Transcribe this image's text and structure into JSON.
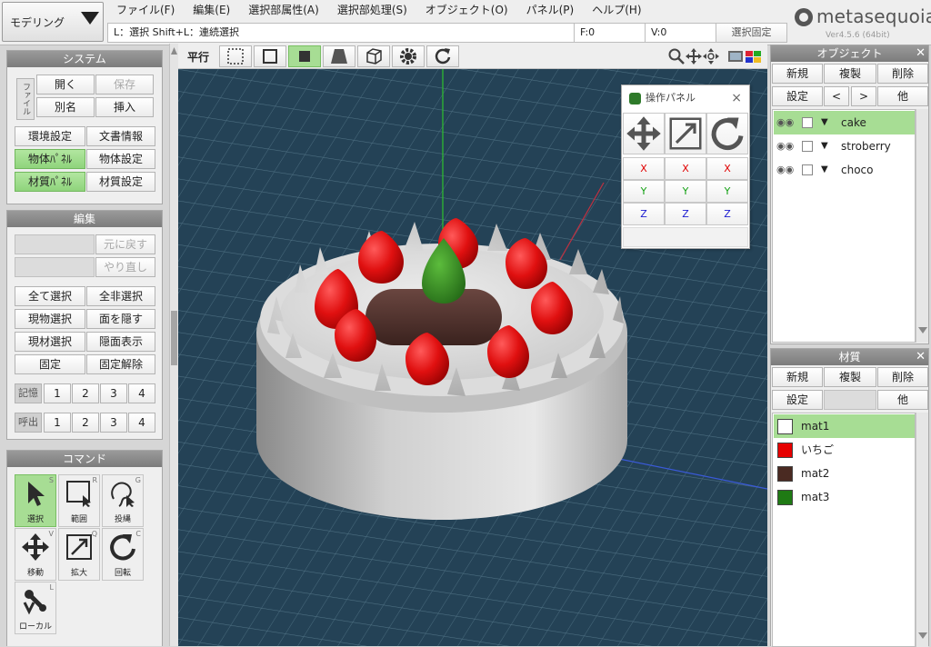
{
  "mode_select": {
    "value": "モデリング"
  },
  "menu": [
    "ファイル(F)",
    "編集(E)",
    "選択部属性(A)",
    "選択部処理(S)",
    "オブジェクト(O)",
    "パネル(P)",
    "ヘルプ(H)"
  ],
  "status": {
    "hint": "L：選択  Shift+L：連続選択",
    "faces": "F:0",
    "vertices": "V:0",
    "lock_label": "選択固定"
  },
  "logo": {
    "name": "metasequoia4",
    "version": "Ver4.5.6 (64bit)"
  },
  "system_panel": {
    "title": "システム",
    "file_tab": "ファイル",
    "open": "開く",
    "save": "保存",
    "save_as": "別名",
    "insert": "挿入",
    "env_settings": "環境設定",
    "doc_info": "文書情報",
    "object_panel": "物体ﾊﾟﾈﾙ",
    "object_settings": "物体設定",
    "material_panel": "材質ﾊﾟﾈﾙ",
    "material_settings": "材質設定"
  },
  "edit_panel": {
    "title": "編集",
    "undo": "元に戻す",
    "redo": "やり直し",
    "select_all": "全て選択",
    "deselect_all": "全非選択",
    "select_current_object": "現物選択",
    "hide_faces": "面を隠す",
    "select_current_material": "現材選択",
    "show_hidden": "隠面表示",
    "lock": "固定",
    "unlock": "固定解除",
    "memory_label": "記憶",
    "recall_label": "呼出",
    "slots": [
      "1",
      "2",
      "3",
      "4"
    ]
  },
  "command_panel": {
    "title": "コマンド",
    "commands": [
      {
        "label": "選択",
        "shortcut": "S",
        "icon": "cursor-arrow-icon"
      },
      {
        "label": "範囲",
        "shortcut": "R",
        "icon": "rectangle-select-icon"
      },
      {
        "label": "投縄",
        "shortcut": "G",
        "icon": "lasso-icon"
      },
      {
        "label": "移動",
        "shortcut": "V",
        "icon": "move-icon"
      },
      {
        "label": "拡大",
        "shortcut": "Q",
        "icon": "scale-icon"
      },
      {
        "label": "回転",
        "shortcut": "C",
        "icon": "rotate-icon"
      },
      {
        "label": "ローカル",
        "shortcut": "L",
        "icon": "local-tool-icon"
      }
    ]
  },
  "viewport_toolbar": {
    "projection": "平行"
  },
  "operation_panel": {
    "title": "操作パネル",
    "axes": [
      "X",
      "Y",
      "Z"
    ]
  },
  "object_panel": {
    "title": "オブジェクト",
    "new": "新規",
    "duplicate": "複製",
    "delete": "削除",
    "settings": "設定",
    "prev": "<",
    "next": ">",
    "other": "他",
    "objects": [
      "cake",
      "stroberry",
      "choco"
    ]
  },
  "material_panel": {
    "title": "材質",
    "new": "新規",
    "duplicate": "複製",
    "delete": "削除",
    "settings": "設定",
    "other": "他",
    "materials": [
      {
        "name": "mat1",
        "color": "#ffffff"
      },
      {
        "name": "いちご",
        "color": "#e60000"
      },
      {
        "name": "mat2",
        "color": "#4a2a22"
      },
      {
        "name": "mat3",
        "color": "#1f7a14"
      }
    ]
  },
  "colors": {
    "selected": "#a7dd94",
    "viewport_bg": "#244256",
    "axis_x": "#e00000",
    "axis_y": "#12a012",
    "axis_z": "#1a1ad0"
  }
}
